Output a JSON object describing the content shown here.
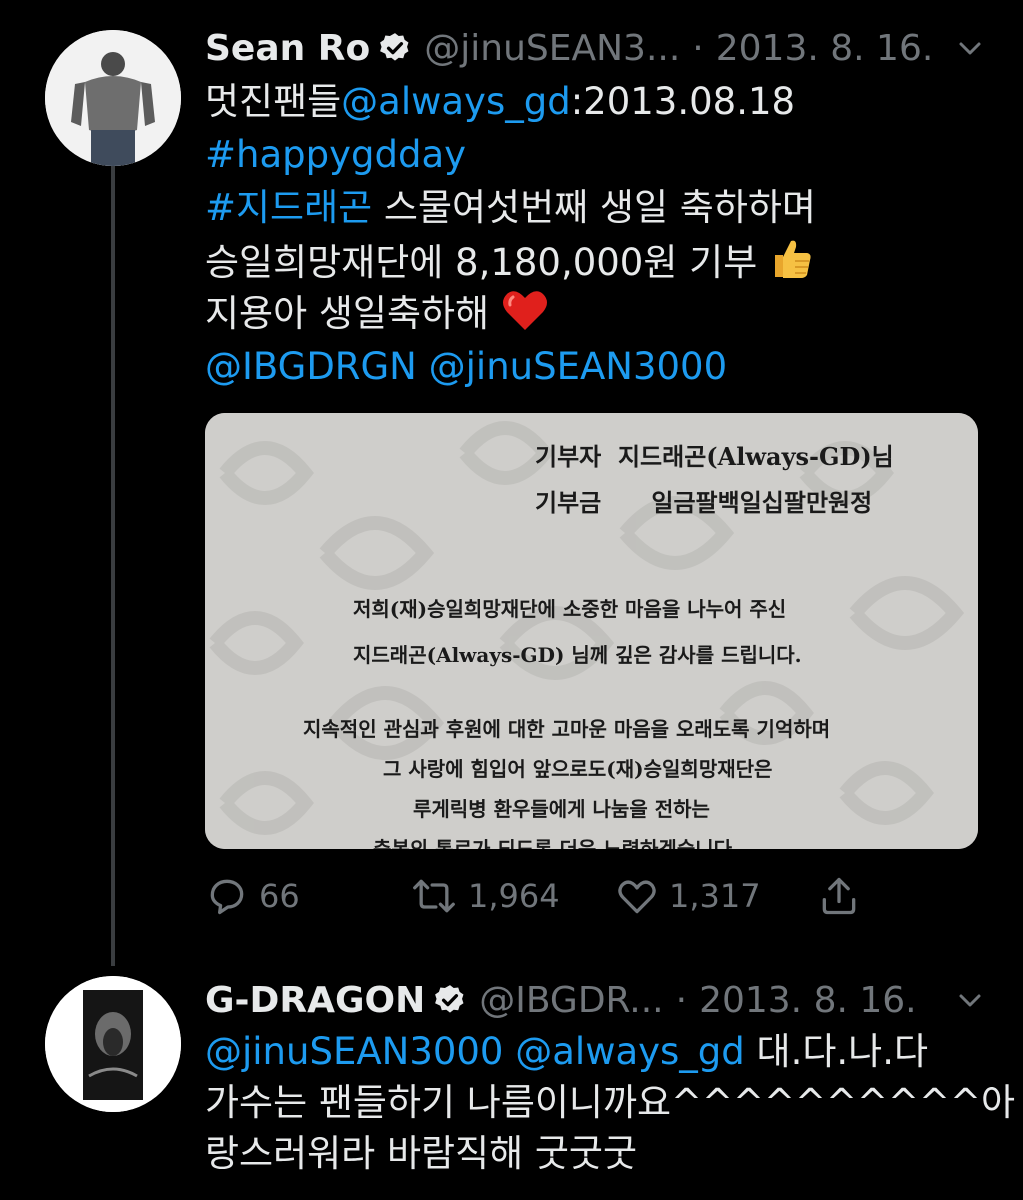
{
  "tweet1": {
    "name": "Sean Ro",
    "handle": "@jinuSEAN3...",
    "separator": "·",
    "date": "2013. 8. 16.",
    "line1_prefix": "멋진팬들",
    "line1_mention": "@always_gd",
    "line1_suffix": ":2013.08.18",
    "line2_hashtag": "#happygdday",
    "line3_hashtag": "#지드래곤",
    "line3_text": " 스물여섯번째 생일 축하하며",
    "line4_text": "승일희망재단에 8,180,000원 기부",
    "line5_text": "지용아 생일축하해",
    "mention_a": "@IBGDRGN",
    "mention_b": "@jinuSEAN3000",
    "media": {
      "donor_label": "기부자",
      "donor_value": "지드래곤(Always-GD)님",
      "amount_label": "기부금",
      "amount_value": "일금팔백일십팔만원정",
      "body_1": "저희(재)승일희망재단에 소중한 마음을 나누어 주신",
      "body_2": "지드래곤(Always-GD) 님께 깊은 감사를 드립니다.",
      "body_3": "지속적인 관심과 후원에 대한 고마운 마음을 오래도록 기억하며",
      "body_4": "그 사랑에 힘입어 앞으로도(재)승일희망재단은",
      "body_5": "루게릭병 환우들에게 나눔을 전하는",
      "body_6": "축복의 통로가 되도록 더욱 노력하겠습니다."
    },
    "replies": "66",
    "retweets": "1,964",
    "likes": "1,317"
  },
  "tweet2": {
    "name": "G-DRAGON",
    "handle": "@IBGDR...",
    "separator": "·",
    "date": "2013. 8. 16.",
    "mention_a": "@jinuSEAN3000",
    "mention_b": "@always_gd",
    "line1_suffix": " 대.다.나.다",
    "line2_text": "가수는 팬들하기 나름이니까요^^^^^^^^^^아 자",
    "line3_text": "랑스러워라 바람직해 굿굿굿"
  },
  "colors": {
    "link": "#1d9bf0",
    "muted": "#71767b",
    "background": "#000000",
    "text": "#e7e9ea"
  },
  "icons": [
    "verified-badge-icon",
    "chevron-down-icon",
    "reply-icon",
    "retweet-icon",
    "like-icon",
    "share-icon",
    "thumbs-up-emoji",
    "red-heart-emoji"
  ]
}
